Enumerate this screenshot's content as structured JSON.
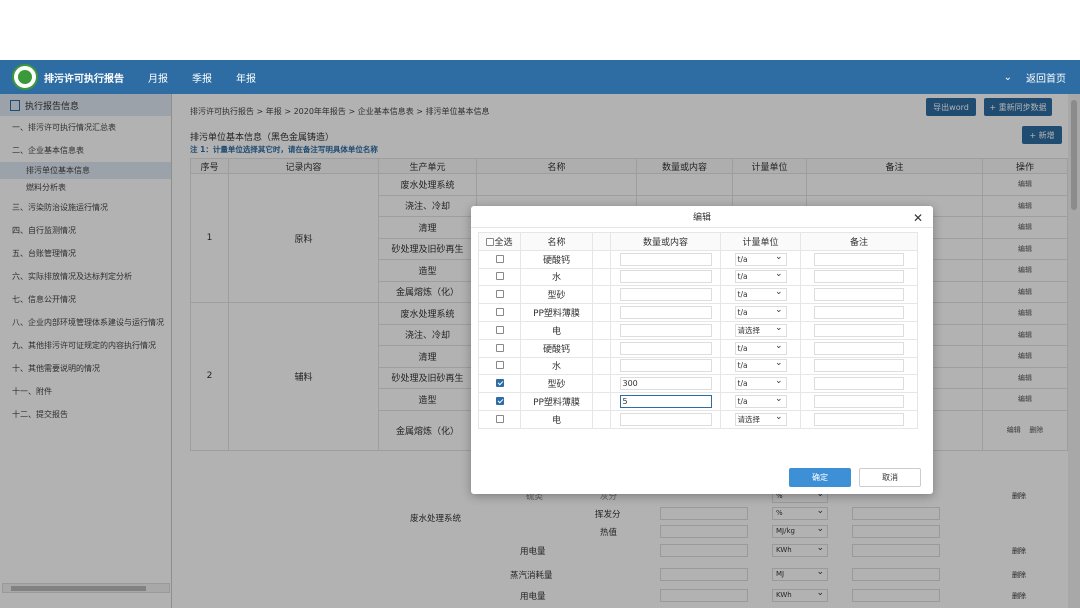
{
  "header": {
    "app_title": "排污许可执行报告",
    "nav": [
      "月报",
      "季报",
      "年报"
    ],
    "back_home": "返回首页"
  },
  "sidebar": {
    "head": "执行报告信息",
    "items": [
      "一、排污许可执行情况汇总表",
      "二、企业基本信息表",
      "三、污染防治设施运行情况",
      "四、自行监测情况",
      "五、台账管理情况",
      "六、实际排放情况及达标判定分析",
      "七、信息公开情况",
      "八、企业内部环境管理体系建设与运行情况",
      "九、其他排污许可证规定的内容执行情况",
      "十、其他需要说明的情况",
      "十一、附件",
      "十二、提交报告"
    ],
    "subitems": [
      "排污单位基本信息",
      "燃料分析表"
    ]
  },
  "main": {
    "breadcrumb": "排污许可执行报告 > 年报 > 2020年年报告 > 企业基本信息表 > 排污单位基本信息",
    "export_word": "导出word",
    "refresh_sync": "+ 重新同步数据",
    "add": "+ 新增",
    "section_title": "排污单位基本信息（黑色金属铸造）",
    "note": "注 1：计量单位选择其它时，请在备注写明具体单位名称",
    "table_headers": [
      "序号",
      "记录内容",
      "生产单元",
      "名称",
      "数量或内容",
      "计量单位",
      "备注",
      "操作"
    ],
    "rows_group1": {
      "no": "1",
      "content": "原料"
    },
    "rows_group2": {
      "no": "2",
      "content": "辅料"
    },
    "units": [
      "废水处理系统",
      "浇注、冷却",
      "清理",
      "砂处理及旧砂再生",
      "造型",
      "金属熔炼（化）",
      "废水处理系统",
      "浇注、冷却",
      "清理",
      "砂处理及旧砂再生",
      "造型",
      "金属熔炼（化）"
    ],
    "edit_label": "编辑",
    "delete_label": "删除"
  },
  "modal": {
    "title": "编辑",
    "headers": [
      "全选",
      "名称",
      "数量或内容",
      "计量单位",
      "备注"
    ],
    "rows": [
      {
        "checked": false,
        "name": "硬酸钙",
        "value": "",
        "unit": "t/a"
      },
      {
        "checked": false,
        "name": "水",
        "value": "",
        "unit": "t/a"
      },
      {
        "checked": false,
        "name": "型砂",
        "value": "",
        "unit": "t/a"
      },
      {
        "checked": false,
        "name": "PP塑料薄膜",
        "value": "",
        "unit": "t/a"
      },
      {
        "checked": false,
        "name": "电",
        "value": "",
        "unit": "请选择"
      },
      {
        "checked": false,
        "name": "硬酸钙",
        "value": "",
        "unit": "t/a"
      },
      {
        "checked": false,
        "name": "水",
        "value": "",
        "unit": "t/a"
      },
      {
        "checked": true,
        "name": "型砂",
        "value": "300",
        "unit": "t/a"
      },
      {
        "checked": true,
        "name": "PP塑料薄膜",
        "value": "5",
        "unit": "t/a"
      },
      {
        "checked": false,
        "name": "电",
        "value": "",
        "unit": "请选择"
      }
    ],
    "ok": "确定",
    "cancel": "取消"
  },
  "lower": {
    "unit_label": "废水处理系统",
    "rows": [
      {
        "name": "挥发分",
        "unit": "%"
      },
      {
        "name": "热值",
        "unit": "MJ/kg"
      },
      {
        "name": "用电量",
        "unit": "KWh"
      },
      {
        "name": "蒸汽消耗量",
        "unit": "MJ"
      },
      {
        "name": "用电量",
        "unit": "KWh"
      }
    ],
    "top_unit": "%",
    "partial_left": "硫类",
    "partial_mid": "灰分"
  }
}
